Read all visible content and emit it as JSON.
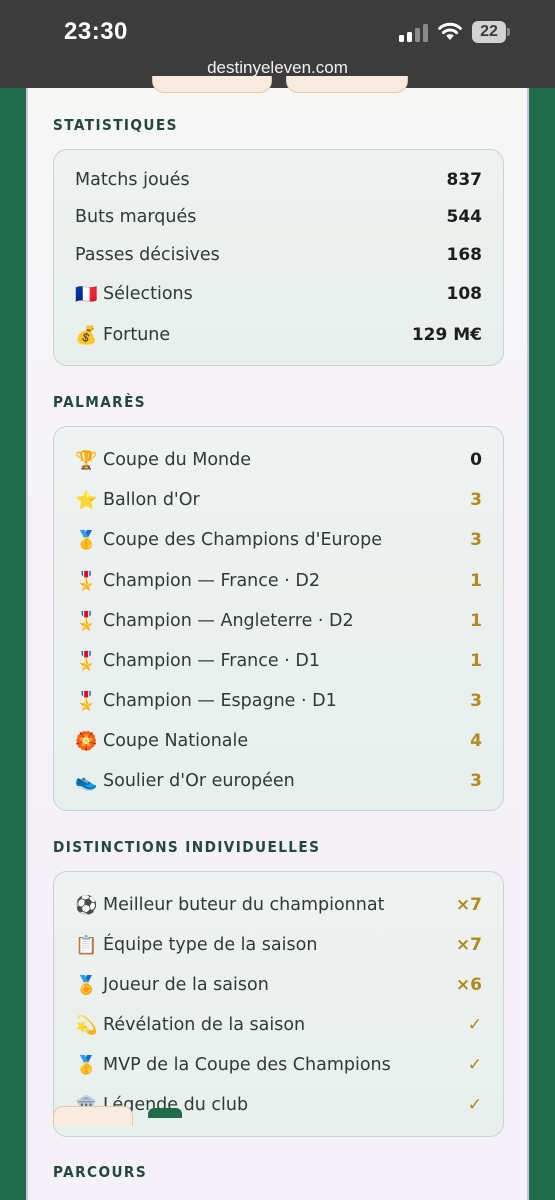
{
  "status_bar": {
    "time": "23:30",
    "battery": "22"
  },
  "browser": {
    "url": "destinyeleven.com"
  },
  "statistiques": {
    "title": "STATISTIQUES",
    "rows": [
      {
        "icon": "",
        "label": "Matchs joués",
        "value": "837"
      },
      {
        "icon": "",
        "label": "Buts marqués",
        "value": "544"
      },
      {
        "icon": "",
        "label": "Passes décisives",
        "value": "168"
      },
      {
        "icon": "🇫🇷",
        "label": "Sélections",
        "value": "108"
      },
      {
        "icon": "💰",
        "label": "Fortune",
        "value": "129 M€"
      }
    ]
  },
  "palmares": {
    "title": "PALMARÈS",
    "rows": [
      {
        "icon": "🏆",
        "label": "Coupe du Monde",
        "value": "0"
      },
      {
        "icon": "⭐",
        "label": "Ballon d'Or",
        "value": "3"
      },
      {
        "icon": "🥇",
        "label": "Coupe des Champions d'Europe",
        "value": "3"
      },
      {
        "icon": "🎖️",
        "label": "Champion — France · D2",
        "value": "1"
      },
      {
        "icon": "🎖️",
        "label": "Champion — Angleterre · D2",
        "value": "1"
      },
      {
        "icon": "🎖️",
        "label": "Champion — France · D1",
        "value": "1"
      },
      {
        "icon": "🎖️",
        "label": "Champion — Espagne · D1",
        "value": "3"
      },
      {
        "icon": "🏵️",
        "label": "Coupe Nationale",
        "value": "4"
      },
      {
        "icon": "👟",
        "label": "Soulier d'Or européen",
        "value": "3"
      }
    ]
  },
  "distinctions": {
    "title": "DISTINCTIONS INDIVIDUELLES",
    "rows": [
      {
        "icon": "⚽",
        "label": "Meilleur buteur du championnat",
        "value": "×7"
      },
      {
        "icon": "📋",
        "label": "Équipe type de la saison",
        "value": "×7"
      },
      {
        "icon": "🏅",
        "label": "Joueur de la saison",
        "value": "×6"
      },
      {
        "icon": "💫",
        "label": "Révélation de la saison",
        "value": "✓"
      },
      {
        "icon": "🥇",
        "label": "MVP de la Coupe des Champions",
        "value": "✓"
      },
      {
        "icon": "🏛️",
        "label": "Légende du club",
        "value": "✓"
      }
    ]
  },
  "parcours": {
    "title": "PARCOURS"
  }
}
